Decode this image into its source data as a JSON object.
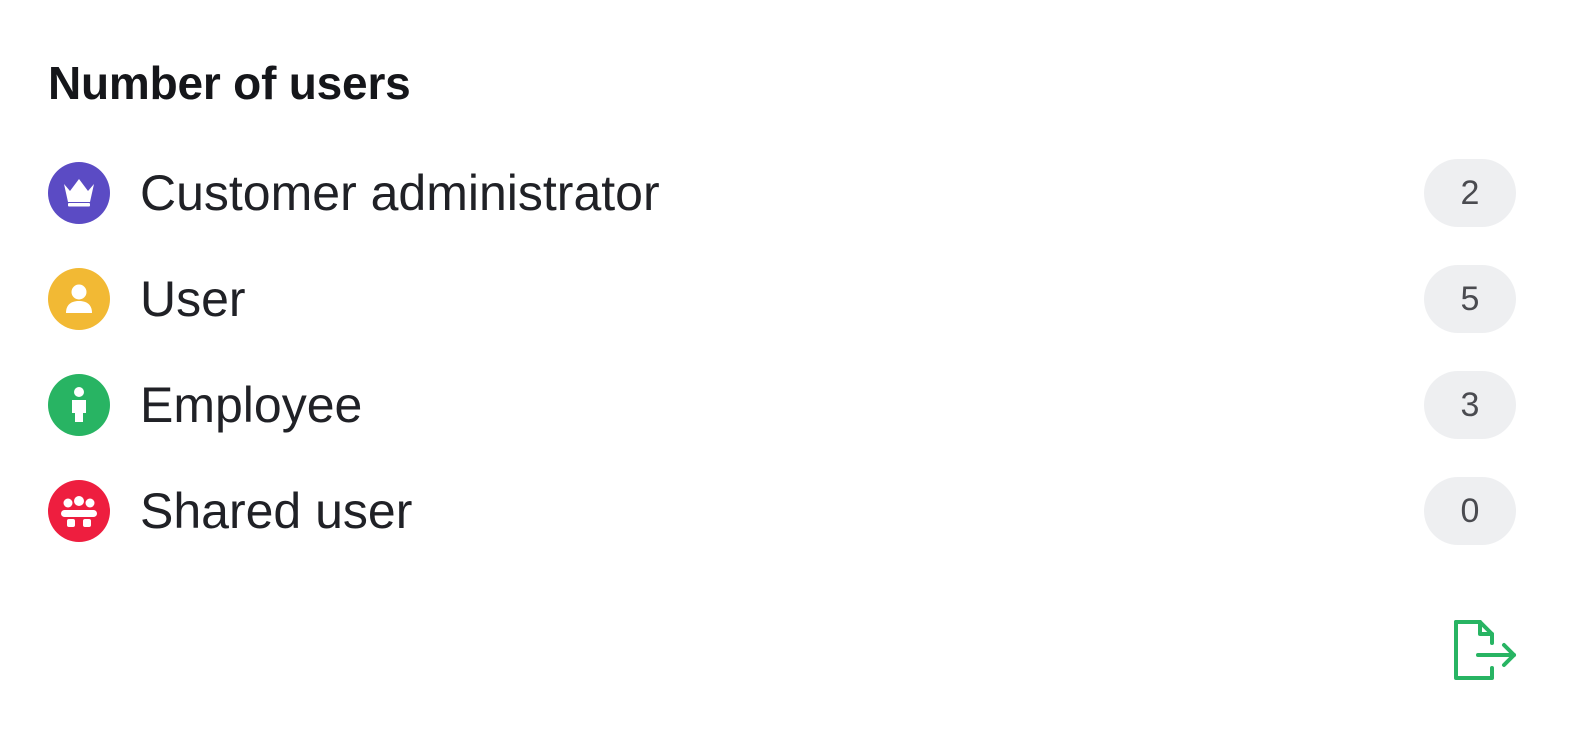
{
  "panel": {
    "title": "Number of users",
    "rows": [
      {
        "label": "Customer administrator",
        "count": "2",
        "icon": "crown-icon",
        "color": "#5b4bc4"
      },
      {
        "label": "User",
        "count": "5",
        "icon": "user-icon",
        "color": "#f2b934"
      },
      {
        "label": "Employee",
        "count": "3",
        "icon": "employee-icon",
        "color": "#28b463"
      },
      {
        "label": "Shared user",
        "count": "0",
        "icon": "group-icon",
        "color": "#ee1e3f"
      }
    ],
    "export_icon": "file-export-icon",
    "export_color": "#28b463"
  }
}
